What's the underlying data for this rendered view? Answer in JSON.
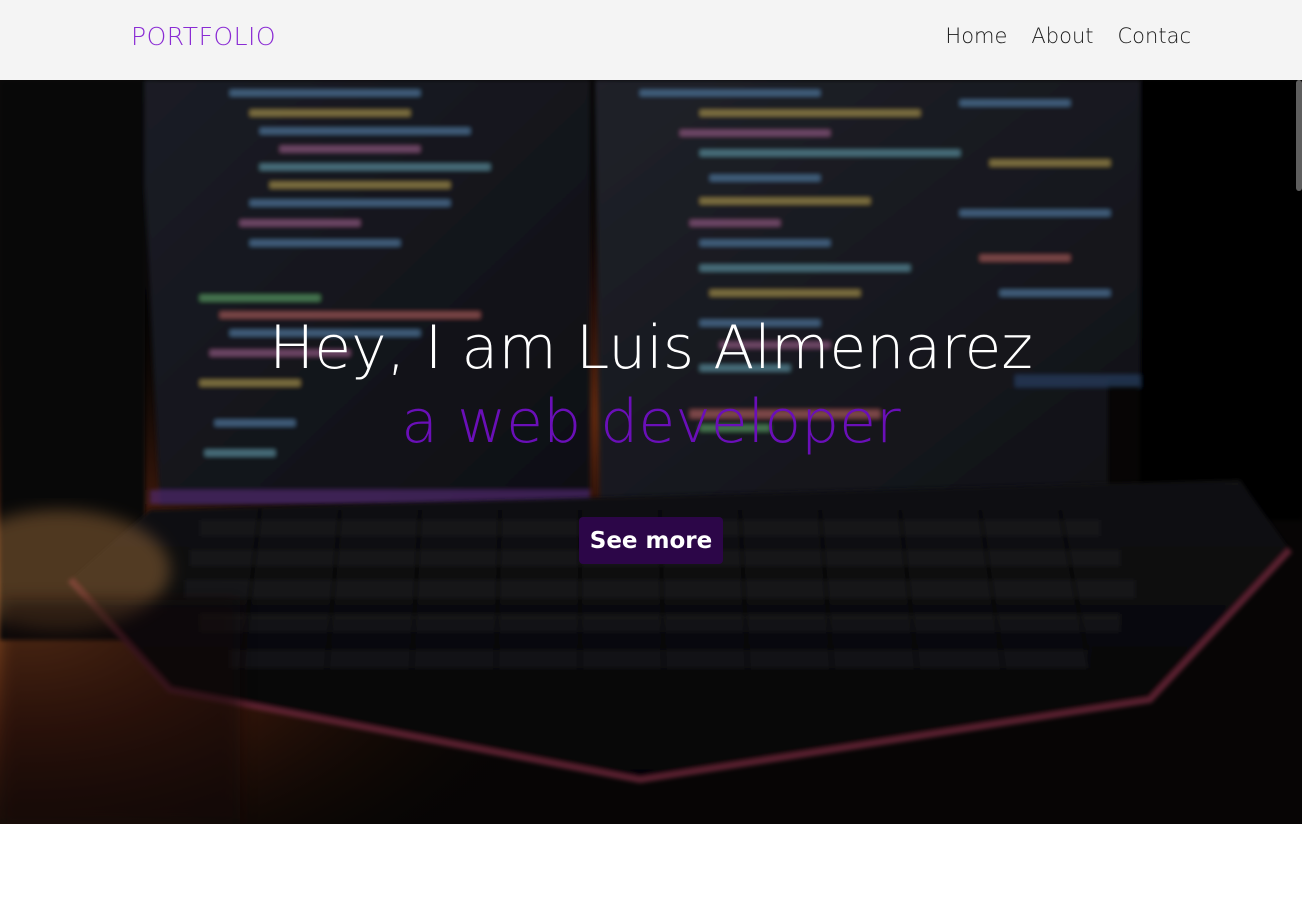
{
  "navbar": {
    "brand": "PORTFOLIO",
    "links": [
      {
        "label": "Home"
      },
      {
        "label": "About"
      },
      {
        "label": "Contac"
      }
    ]
  },
  "hero": {
    "title": "Hey, I am Luis Almenarez",
    "subtitle": "a web developer",
    "button_label": "See more",
    "background_image": "keyboard-and-code-monitors-photo"
  },
  "colors": {
    "brand_accent": "#8a2bd4",
    "subtitle": "#6a0fb8",
    "button_bg": "#2c0648",
    "navbar_bg": "#f4f4f4"
  }
}
